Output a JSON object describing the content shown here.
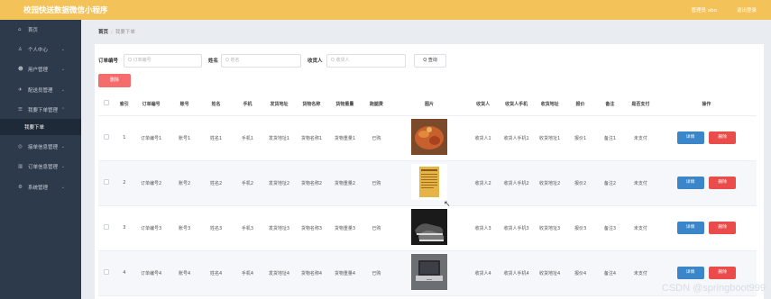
{
  "app": {
    "title": "校园快送数据微信小程序",
    "user": "管理员 abo",
    "logout": "退出登录"
  },
  "sidebar": {
    "items": [
      {
        "icon": "⌂",
        "label": "首页",
        "arrow": ""
      },
      {
        "icon": "♙",
        "label": "个人中心",
        "arrow": "⌄"
      },
      {
        "icon": "☻",
        "label": "用户管理",
        "arrow": "⌄"
      },
      {
        "icon": "✈",
        "label": "配送员管理",
        "arrow": "⌄"
      },
      {
        "icon": "☰",
        "label": "我要下单管理",
        "arrow": "⌃"
      },
      {
        "icon": "",
        "label": "我要下单",
        "arrow": ""
      },
      {
        "icon": "◎",
        "label": "接单信息管理",
        "arrow": "⌄"
      },
      {
        "icon": "▥",
        "label": "订单信息管理",
        "arrow": "⌄"
      },
      {
        "icon": "⚙",
        "label": "系统管理",
        "arrow": "⌄"
      }
    ]
  },
  "breadcrumb": {
    "home": "首页",
    "current": "我要下单"
  },
  "search": {
    "order_label": "订单编号",
    "order_placeholder": "Q 订单编号",
    "name_label": "姓名",
    "name_placeholder": "Q 姓名",
    "receiver_label": "收货人",
    "receiver_placeholder": "Q 收货人",
    "button": "Q 查询"
  },
  "delete_all": "删除",
  "table": {
    "headers": [
      "",
      "索引",
      "订单编号",
      "账号",
      "姓名",
      "手机",
      "发货地址",
      "货物名称",
      "货物重量",
      "跑腿费",
      "图片",
      "收货人",
      "收货人手机",
      "收货地址",
      "报价",
      "备注",
      "是否支付",
      "操作"
    ],
    "rows": [
      {
        "index": "1",
        "order": "订单编号1",
        "account": "账号1",
        "name": "姓名1",
        "phone": "手机1",
        "ship_addr": "发货地址1",
        "goods": "货物名称1",
        "weight": "货物重量1",
        "fee": "已购",
        "receiver": "收货人1",
        "receiver_phone": "收货人手机1",
        "recv_addr": "收货地址1",
        "quote": "报价1",
        "remark": "备注1",
        "paid": "未支付"
      },
      {
        "index": "2",
        "order": "订单编号2",
        "account": "账号2",
        "name": "姓名2",
        "phone": "手机2",
        "ship_addr": "发货地址2",
        "goods": "货物名称2",
        "weight": "货物重量2",
        "fee": "已购",
        "receiver": "收货人2",
        "receiver_phone": "收货人手机2",
        "recv_addr": "收货地址2",
        "quote": "报价2",
        "remark": "备注2",
        "paid": "未支付"
      },
      {
        "index": "3",
        "order": "订单编号3",
        "account": "账号3",
        "name": "姓名3",
        "phone": "手机3",
        "ship_addr": "发货地址3",
        "goods": "货物名称3",
        "weight": "货物重量3",
        "fee": "已购",
        "receiver": "收货人3",
        "receiver_phone": "收货人手机3",
        "recv_addr": "收货地址3",
        "quote": "报价3",
        "remark": "备注3",
        "paid": "未支付"
      },
      {
        "index": "4",
        "order": "订单编号4",
        "account": "账号4",
        "name": "姓名4",
        "phone": "手机4",
        "ship_addr": "发货地址4",
        "goods": "货物名称4",
        "weight": "货物重量4",
        "fee": "已购",
        "receiver": "收货人4",
        "receiver_phone": "收货人手机4",
        "recv_addr": "收货地址4",
        "quote": "报价4",
        "remark": "备注4",
        "paid": "未支付"
      }
    ],
    "edit_label": "详情",
    "delete_label": "删除"
  },
  "watermark": "CSDN @springboot999",
  "colors": {
    "topbar": "#f3c35a",
    "sidebar": "#2d3a4b",
    "edit": "#3a86c8",
    "delete": "#ea4c4c"
  }
}
